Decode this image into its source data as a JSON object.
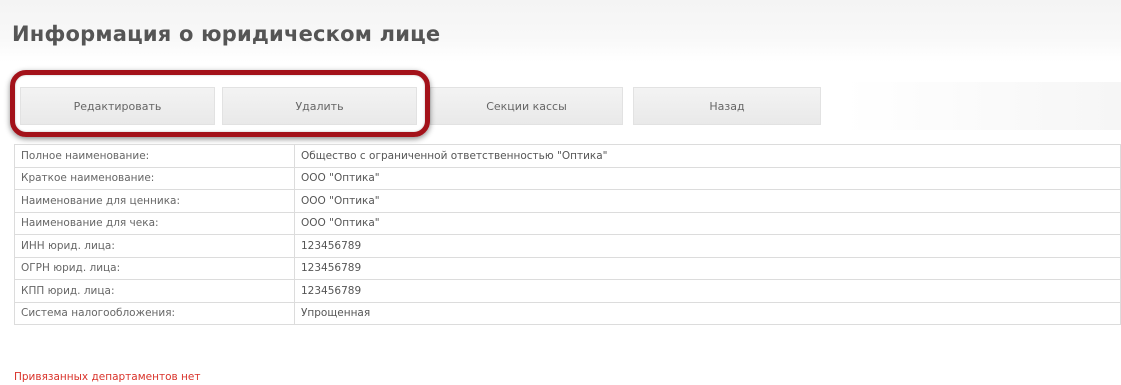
{
  "page": {
    "title": "Информация о юридическом лице"
  },
  "toolbar": {
    "edit_label": "Редактировать",
    "delete_label": "Удалить",
    "kassa_sections_label": "Секции кассы",
    "back_label": "Назад"
  },
  "details": {
    "rows": [
      {
        "label": "Полное наименование:",
        "value": "Общество с ограниченной ответственностью \"Оптика\""
      },
      {
        "label": "Краткое наименование:",
        "value": "ООО \"Оптика\""
      },
      {
        "label": "Наименование для ценника:",
        "value": "ООО \"Оптика\""
      },
      {
        "label": "Наименование для чека:",
        "value": "ООО \"Оптика\""
      },
      {
        "label": "ИНН юрид. лица:",
        "value": "123456789"
      },
      {
        "label": "ОГРН юрид. лица:",
        "value": "123456789"
      },
      {
        "label": "КПП юрид. лица:",
        "value": "123456789"
      },
      {
        "label": "Система налогообложения:",
        "value": "Упрощенная"
      }
    ]
  },
  "footer": {
    "no_departments": "Привязанных департаментов нет"
  },
  "colors": {
    "highlight_border": "#a3121a",
    "footnote_text": "#d9332b",
    "button_bg": "#efefef",
    "table_border": "#dcdcdc"
  }
}
